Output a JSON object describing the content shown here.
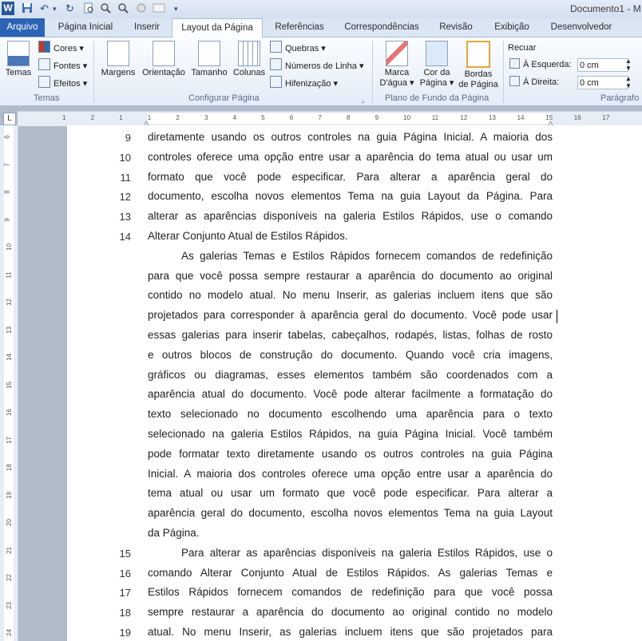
{
  "window": {
    "app_icon": "W",
    "title": "Documento1 - M"
  },
  "quick_access": {
    "undo_glyph": "↶",
    "redo_glyph": "↻",
    "customize_glyph": "▾"
  },
  "tabs": [
    {
      "label": "Arquivo"
    },
    {
      "label": "Página Inicial"
    },
    {
      "label": "Inserir"
    },
    {
      "label": "Layout da Página"
    },
    {
      "label": "Referências"
    },
    {
      "label": "Correspondências"
    },
    {
      "label": "Revisão"
    },
    {
      "label": "Exibição"
    },
    {
      "label": "Desenvolvedor"
    }
  ],
  "ribbon": {
    "temas": {
      "big": "Temas",
      "cores": "Cores",
      "fontes": "Fontes",
      "efeitos": "Efeitos",
      "group": "Temas"
    },
    "configurar": {
      "margens": "Margens",
      "orientacao": "Orientação",
      "tamanho": "Tamanho",
      "colunas": "Colunas",
      "quebras": "Quebras",
      "numeros": "Números de Linha",
      "hifenizacao": "Hifenização",
      "group": "Configurar Página"
    },
    "plano": {
      "marca_1": "Marca",
      "marca_2": "D'água",
      "cor_1": "Cor da",
      "cor_2": "Página",
      "bordas_1": "Bordas",
      "bordas_2": "de Página",
      "group": "Plano de Fundo da Página"
    },
    "paragrafo": {
      "recuar": "Recuar",
      "esquerda_label": "À Esquerda:",
      "esquerda_value": "0 cm",
      "direita_label": "À Direita:",
      "direita_value": "0 cm",
      "group": "Parágrafo"
    }
  },
  "ruler": {
    "corner": "L",
    "h_ticks": [
      "1",
      "2",
      "1",
      "1",
      "2",
      "3",
      "4",
      "5",
      "6",
      "7",
      "8",
      "9",
      "10",
      "11",
      "12",
      "13",
      "14",
      "15",
      "16",
      "17"
    ],
    "v_ticks": [
      "6",
      "7",
      "8",
      "9",
      "10",
      "11",
      "12",
      "13",
      "14",
      "15",
      "16",
      "17",
      "18",
      "19",
      "20",
      "21",
      "22",
      "23",
      "24"
    ]
  },
  "document": {
    "lines": [
      {
        "num": "9",
        "text": "diretamente usando os outros controles na guia Página Inicial. A maioria dos"
      },
      {
        "num": "10",
        "text": "controles oferece uma opção entre usar a aparência do tema atual ou usar um"
      },
      {
        "num": "11",
        "text": "formato que você pode especificar. Para alterar a aparência geral do"
      },
      {
        "num": "12",
        "text": "documento, escolha novos elementos Tema na guia Layout da Página. Para"
      },
      {
        "num": "13",
        "text": "alterar as aparências disponíveis na galeria Estilos Rápidos, use o comando"
      },
      {
        "num": "14",
        "text": "Alterar Conjunto Atual de Estilos Rápidos."
      },
      {
        "num": "",
        "text": "As galerias Temas e Estilos Rápidos fornecem comandos de redefinição"
      },
      {
        "num": "",
        "text": "para que você possa sempre restaurar a aparência do documento ao original"
      },
      {
        "num": "",
        "text": "contido no modelo atual. No menu Inserir, as galerias incluem itens que são"
      },
      {
        "num": "",
        "text": "projetados para corresponder à aparência geral do documento. Você pode usar"
      },
      {
        "num": "",
        "text": "essas galerias para inserir tabelas, cabeçalhos, rodapés, listas, folhas de rosto"
      },
      {
        "num": "",
        "text": "e outros blocos de construção do documento. Quando você cria imagens,"
      },
      {
        "num": "",
        "text": "gráficos ou diagramas, esses elementos também são coordenados com a"
      },
      {
        "num": "",
        "text": "aparência atual do documento. Você pode alterar facilmente a formatação do"
      },
      {
        "num": "",
        "text": "texto selecionado no documento escolhendo uma aparência para o texto"
      },
      {
        "num": "",
        "text": "selecionado na galeria Estilos Rápidos, na guia Página Inicial. Você também"
      },
      {
        "num": "",
        "text": "pode formatar texto diretamente usando os outros controles na guia Página"
      },
      {
        "num": "",
        "text": "Inicial. A maioria dos controles oferece uma opção entre usar a aparência do"
      },
      {
        "num": "",
        "text": "tema atual ou usar um formato que você pode especificar. Para alterar a"
      },
      {
        "num": "",
        "text": "aparência geral do documento, escolha novos elementos Tema na guia Layout"
      },
      {
        "num": "",
        "text": "da Página."
      },
      {
        "num": "15",
        "text": "Para alterar as aparências disponíveis na galeria Estilos Rápidos, use o"
      },
      {
        "num": "16",
        "text": "comando Alterar Conjunto Atual de Estilos Rápidos. As galerias Temas e"
      },
      {
        "num": "17",
        "text": "Estilos Rápidos fornecem comandos de redefinição para que você possa"
      },
      {
        "num": "18",
        "text": "sempre restaurar a aparência do documento ao original contido no modelo"
      },
      {
        "num": "19",
        "text": "atual. No menu Inserir, as galerias incluem itens que são projetados para"
      }
    ]
  }
}
